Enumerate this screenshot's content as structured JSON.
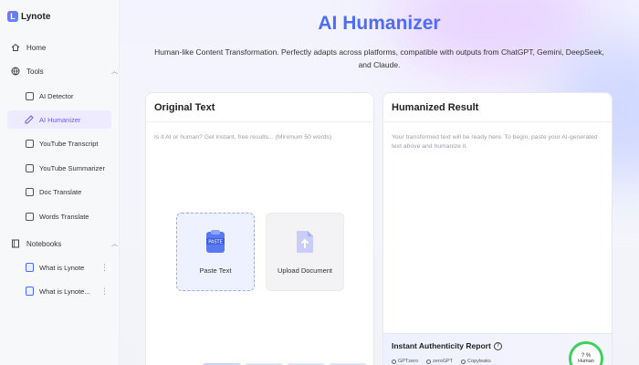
{
  "app": {
    "name": "Lynote",
    "logo_letter": "L"
  },
  "sidebar": {
    "home": "Home",
    "tools": {
      "label": "Tools",
      "items": [
        {
          "label": "AI Detector"
        },
        {
          "label": "AI Humanizer"
        },
        {
          "label": "YouTube Transcript"
        },
        {
          "label": "YouTube Summarizer"
        },
        {
          "label": "Doc Translate"
        },
        {
          "label": "Words Translate"
        }
      ]
    },
    "notebooks": {
      "label": "Notebooks",
      "items": [
        {
          "label": "What is Lynote"
        },
        {
          "label": "What is Lynote..."
        }
      ]
    }
  },
  "main": {
    "title": "AI Humanizer",
    "subtitle": "Human-like Content Transformation. Perfectly adapts across platforms, compatible with outputs from ChatGPT, Gemini, DeepSeek, and Claude.",
    "original": {
      "header": "Original Text",
      "placeholder": "Is it AI or human? Get instant, free results... (Minimum 50 words)",
      "paste_label": "Paste Text",
      "upload_label": "Upload Document",
      "paste_icon_text": "PASTE"
    },
    "result": {
      "header": "Humanized Result",
      "placeholder": "Your transformed text will be ready here. To begin, paste your AI-generated text above and humanize it.",
      "report_title": "Instant Authenticity Report",
      "detectors": [
        "GPTzero",
        "zeroGPT",
        "Copyleaks"
      ],
      "score": "? %",
      "score_label": "Human"
    }
  },
  "colors": {
    "accent": "#4f6cf3",
    "active_bg": "#eeeaff",
    "gauge": "#3fcf61"
  }
}
